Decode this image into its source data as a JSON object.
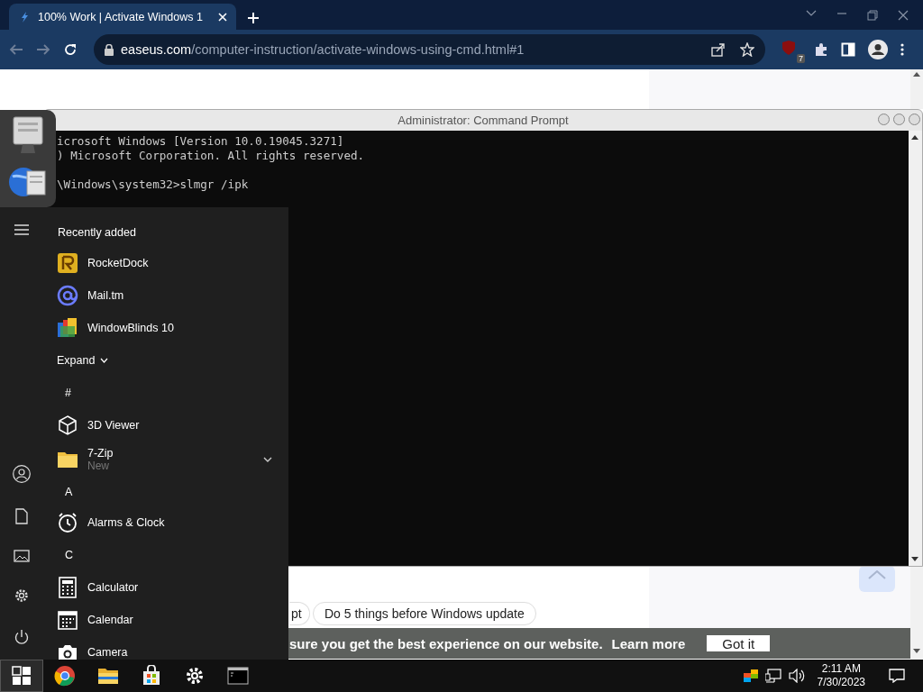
{
  "browser": {
    "tabs": [
      {
        "title": "100% Work | Activate Windows 1",
        "selected": true
      }
    ],
    "address": {
      "host": "easeus.com",
      "path": "/computer-instruction/activate-windows-using-cmd.html#1"
    },
    "extension_badge": "7"
  },
  "page": {
    "chips": [
      "pt",
      "Do 5 things before Windows update"
    ],
    "cookie_bar": {
      "text": "sure you get the best experience on our website.",
      "link": "Learn more",
      "button": "Got it"
    }
  },
  "command_prompt": {
    "title": "Administrator:  Command Prompt",
    "paragraphs": [
      [
        "icrosoft Windows [Version 10.0.19045.3271]",
        ") Microsoft Corporation. All rights reserved."
      ],
      [
        "\\Windows\\system32>slmgr /ipk"
      ]
    ]
  },
  "start_menu": {
    "items": [
      {
        "kind": "heading",
        "text": "Recently added"
      },
      {
        "kind": "app",
        "text": "RocketDock"
      },
      {
        "kind": "app",
        "text": "Mail.tm"
      },
      {
        "kind": "app",
        "text": "WindowBlinds 10"
      },
      {
        "kind": "expand",
        "text": "Expand"
      },
      {
        "kind": "letter",
        "text": "#"
      },
      {
        "kind": "app",
        "text": "3D Viewer"
      },
      {
        "kind": "app",
        "text": "7-Zip",
        "subtitle": "New",
        "expandable": true
      },
      {
        "kind": "letter",
        "text": "A"
      },
      {
        "kind": "app",
        "text": "Alarms & Clock"
      },
      {
        "kind": "letter",
        "text": "C"
      },
      {
        "kind": "app",
        "text": "Calculator"
      },
      {
        "kind": "app",
        "text": "Calendar"
      },
      {
        "kind": "app",
        "text": "Camera"
      }
    ]
  },
  "taskbar": {
    "start_open": true,
    "clock": {
      "time": "2:11 AM",
      "date": "7/30/2023"
    }
  }
}
